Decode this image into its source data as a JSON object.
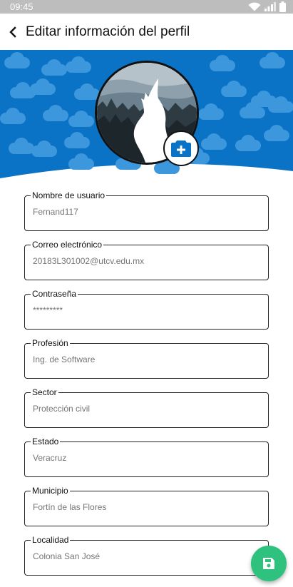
{
  "status_bar": {
    "time": "09:45",
    "icons": [
      "wifi-icon",
      "signal-icon",
      "battery-icon"
    ]
  },
  "app_bar": {
    "back_icon": "arrow-back-icon",
    "title": "Editar información del perfil"
  },
  "banner": {
    "color": "#0a73c6",
    "cloud_color": "#3d97dd"
  },
  "avatar": {
    "image": "wolf-howling-silhouette",
    "camera_icon": "add-photo-icon"
  },
  "form": {
    "fields": [
      {
        "label": "Nombre de usuario",
        "value": "Fernand117"
      },
      {
        "label": "Correo electrónico",
        "value": "20183L301002@utcv.edu.mx"
      },
      {
        "label": "Contraseña",
        "value": "*********"
      },
      {
        "label": "Profesión",
        "value": "Ing. de Software"
      },
      {
        "label": "Sector",
        "value": "Protección civil"
      },
      {
        "label": "Estado",
        "value": "Veracruz"
      },
      {
        "label": "Municipio",
        "value": "Fortín de las Flores"
      },
      {
        "label": "Localidad",
        "value": "Colonia San José"
      }
    ]
  },
  "fab": {
    "icon": "save-icon",
    "color": "#2ec27e"
  }
}
